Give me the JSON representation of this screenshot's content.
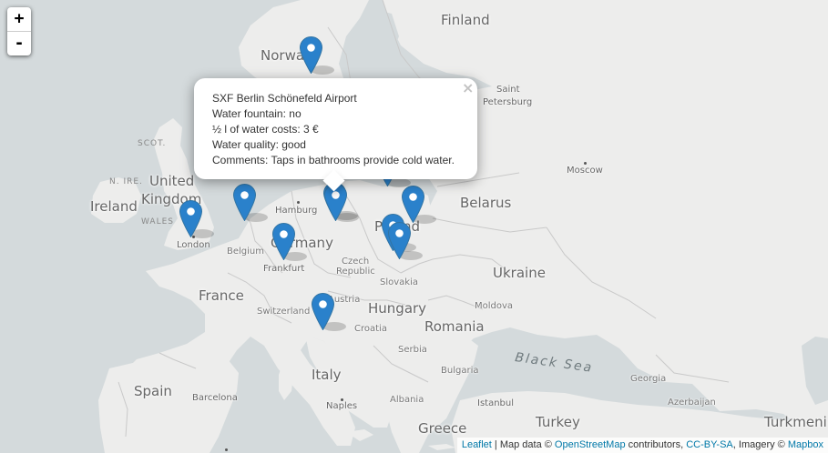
{
  "zoom": {
    "in_label": "+",
    "out_label": "-"
  },
  "labels": {
    "countries": {
      "finland": "Finland",
      "norway": "Norway",
      "ireland": "Ireland",
      "united": "United",
      "kingdom": "Kingdom",
      "belarus": "Belarus",
      "germany": "Germany",
      "poland": "Poland",
      "ukraine": "Ukraine",
      "france": "France",
      "hungary": "Hungary",
      "romania": "Romania",
      "italy": "Italy",
      "spain": "Spain",
      "greece": "Greece",
      "turkey": "Turkey",
      "turkmenistan": "Turkmeni"
    },
    "small_countries": {
      "belgium": "Belgium",
      "czech": "Czech",
      "republic": "Republic",
      "slovakia": "Slovakia",
      "austria": "Austria",
      "switzerland": "Switzerland",
      "moldova": "Moldova",
      "croatia": "Croatia",
      "serbia": "Serbia",
      "bulgaria": "Bulgaria",
      "albania": "Albania",
      "georgia": "Georgia",
      "azerbaijan": "Azerbaijan"
    },
    "regions": {
      "scot": "SCOT.",
      "wales": "WALES",
      "n_ire": "N. IRE."
    },
    "cities": {
      "london": "London",
      "hamburg": "Hamburg",
      "frankfurt": "Frankfurt",
      "saint": "Saint",
      "petersburg": "Petersburg",
      "moscow": "Moscow",
      "barcelona": "Barcelona",
      "naples": "Naples",
      "istanbul": "Istanbul"
    },
    "seas": {
      "black_sea": "Black Sea"
    }
  },
  "popup": {
    "close_symbol": "×",
    "lines": [
      "SXF Berlin Schönefeld Airport",
      "Water fountain: no",
      "½ l of water costs: 3 €",
      "Water quality: good",
      "Comments: Taps in bathrooms provide cold water."
    ]
  },
  "attribution": {
    "leaflet": "Leaflet",
    "sep1": " | Map data © ",
    "osm": "OpenStreetMap",
    "sep2": " contributors, ",
    "license": "CC-BY-SA",
    "sep3": ", Imagery © ",
    "imagery": "Mapbox"
  },
  "colors": {
    "marker": "#2a81cb",
    "marker_dark": "#3274a3",
    "land": "#ededec",
    "water": "#d4dadc",
    "link": "#0078a8"
  }
}
